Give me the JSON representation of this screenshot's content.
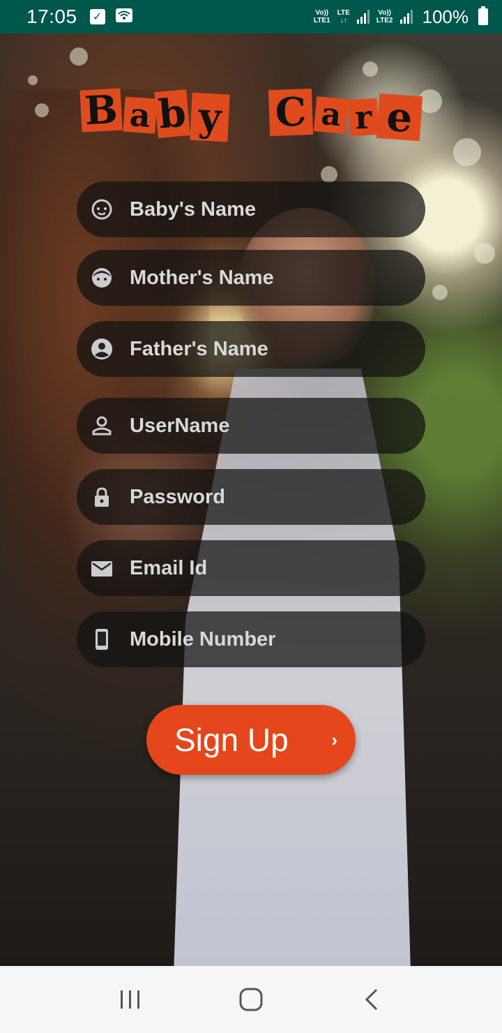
{
  "status_bar": {
    "time": "17:05",
    "sim1_top": "Vo))",
    "sim1_bottom": "LTE1",
    "lte_top": "LTE",
    "lte_bottom": "↓↑",
    "sim2_top": "Vo))",
    "sim2_bottom": "LTE2",
    "battery": "100%",
    "icons": [
      "checkbox-icon",
      "wifi-icon",
      "signal-icon",
      "battery-icon"
    ]
  },
  "app": {
    "title_letters": [
      "B",
      "a",
      "b",
      "y",
      "C",
      "a",
      "r",
      "e"
    ],
    "accent_color": "#e5461b"
  },
  "form": {
    "fields": [
      {
        "label": "Baby's Name",
        "icon": "baby-face-icon"
      },
      {
        "label": "Mother's Name",
        "icon": "face-icon"
      },
      {
        "label": "Father's Name",
        "icon": "account-circle-icon"
      },
      {
        "label": "UserName",
        "icon": "person-outline-icon"
      },
      {
        "label": "Password",
        "icon": "lock-icon"
      },
      {
        "label": "Email Id",
        "icon": "mail-icon"
      },
      {
        "label": "Mobile Number",
        "icon": "phone-icon"
      }
    ],
    "submit_label": "Sign Up",
    "submit_icon": "chevron-right-icon"
  },
  "nav_bar": {
    "buttons": [
      "recent-apps-icon",
      "home-icon",
      "back-icon"
    ]
  }
}
